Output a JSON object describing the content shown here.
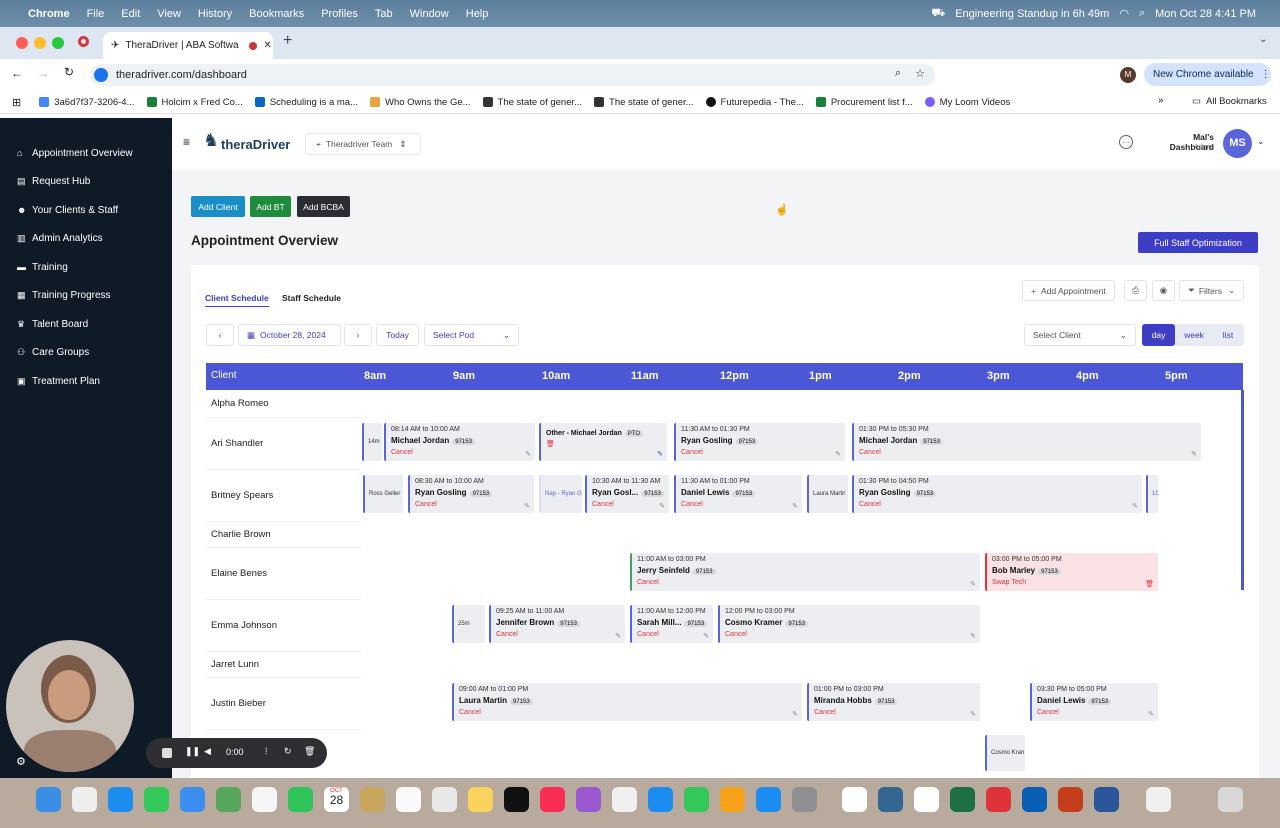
{
  "menubar": {
    "app": "Chrome",
    "items": [
      "File",
      "Edit",
      "View",
      "History",
      "Bookmarks",
      "Profiles",
      "Tab",
      "Window",
      "Help"
    ],
    "status": "Engineering Standup in 6h 49m",
    "datetime": "Mon Oct 28  4:41 PM"
  },
  "tab": {
    "title": "TheraDriver | ABA Softwa"
  },
  "url": "theradriver.com/dashboard",
  "chrome_banner": "New Chrome available",
  "bookmarks": [
    "3a6d7f37-3206-4...",
    "Holcim x Fred Co...",
    "Scheduling is a ma...",
    "Who Owns the Ge...",
    "The state of gener...",
    "The state of gener...",
    "Futurepedia - The...",
    "Procurement list f...",
    "My Loom Videos"
  ],
  "bookmarks_all": "All Bookmarks",
  "sidebar": {
    "items": [
      "Appointment Overview",
      "Request Hub",
      "Your Clients & Staff",
      "Admin Analytics",
      "Training",
      "Training Progress",
      "Talent Board",
      "Care Groups",
      "Treatment Plan"
    ]
  },
  "header": {
    "brand": "theraDriver",
    "team": "Theradriver Team",
    "dashboard_title": "Mal's Dashboard",
    "role": "Admin",
    "avatar": "MS"
  },
  "actions": {
    "add_client": "Add Client",
    "add_bt": "Add BT",
    "add_bcba": "Add BCBA",
    "full_staff": "Full Staff Optimization"
  },
  "page_title": "Appointment Overview",
  "tabs": {
    "client": "Client Schedule",
    "staff": "Staff Schedule"
  },
  "tools": {
    "add_appt": "Add Appointment",
    "filters": "Filters"
  },
  "controls": {
    "date": "October 28, 2024",
    "today": "Today",
    "pod": "Select Pod",
    "client": "Select Client",
    "day": "day",
    "week": "week",
    "list": "list"
  },
  "grid": {
    "client_header": "Client",
    "times": [
      "8am",
      "9am",
      "10am",
      "11am",
      "12pm",
      "1pm",
      "2pm",
      "3pm",
      "4pm",
      "5pm"
    ],
    "clients": [
      "Alpha Romeo",
      "Ari Shandler",
      "Britney Spears",
      "Charlie Brown",
      "Elaine Benes",
      "Emma Johnson",
      "Jarret Lunn",
      "Justin Bieber"
    ]
  },
  "appointments": [
    {
      "time": "08:14 AM to 10:00 AM",
      "name": "Michael Jordan",
      "code": "97153",
      "action": "Cancel"
    },
    {
      "time": "11:30 AM to 01:30 PM",
      "name": "Ryan Gosling",
      "code": "97153",
      "action": "Cancel"
    },
    {
      "time": "01:30 PM to 05:30 PM",
      "name": "Michael Jordan",
      "code": "97153",
      "action": "Cancel"
    },
    {
      "time": "08:30 AM to 10:00 AM",
      "name": "Ryan Gosling",
      "code": "97153",
      "action": "Cancel"
    },
    {
      "time": "10:30 AM to 11:30 AM",
      "name": "Ryan Gosl...",
      "code": "97153",
      "action": "Cancel"
    },
    {
      "time": "11:30 AM to 01:00 PM",
      "name": "Daniel Lewis",
      "code": "97153",
      "action": "Cancel"
    },
    {
      "time": "01:30 PM to 04:50 PM",
      "name": "Ryan Gosling",
      "code": "97153",
      "action": "Cancel"
    },
    {
      "time": "11:00 AM to 03:00 PM",
      "name": "Jerry Seinfeld",
      "code": "97153",
      "action": "Cancel"
    },
    {
      "time": "03:00 PM to 05:00 PM",
      "name": "Bob Marley",
      "code": "97153",
      "action": "Swap Tech"
    },
    {
      "time": "09:25 AM to 11:00 AM",
      "name": "Jennifer Brown",
      "code": "97153",
      "action": "Cancel"
    },
    {
      "time": "11:00 AM to 12:00 PM",
      "name": "Sarah Mill...",
      "code": "97153",
      "action": "Cancel"
    },
    {
      "time": "12:00 PM to 03:00 PM",
      "name": "Cosmo Kramer",
      "code": "97153",
      "action": "Cancel"
    },
    {
      "time": "09:00 AM to 01:00 PM",
      "name": "Laura Martin",
      "code": "97153",
      "action": "Cancel"
    },
    {
      "time": "01:00 PM to 03:00 PM",
      "name": "Miranda Hobbs",
      "code": "97153",
      "action": "Cancel"
    },
    {
      "time": "03:30 PM to 05:00 PM",
      "name": "Daniel Lewis",
      "code": "97153",
      "action": "Cancel"
    }
  ],
  "small_blocks": {
    "a": "14m",
    "b": "Other - Michael Jordan",
    "b_tag": "PTO",
    "c": "Ross Geller",
    "d": "Nap - Ryan G",
    "e": "Laura Martir",
    "f": "25m",
    "g": "Cosmo Kran",
    "h": "1C"
  },
  "recorder": {
    "time": "0:00"
  },
  "dock_date": {
    "month": "OCT",
    "day": "28"
  }
}
